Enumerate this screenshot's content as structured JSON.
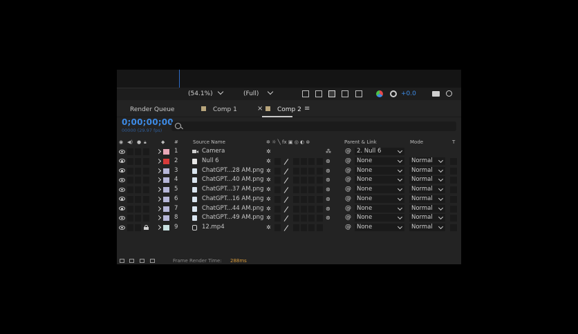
{
  "viewer": {
    "zoom": "(54.1%)",
    "resolution": "(Full)",
    "exposure": "+0.0"
  },
  "tabs": [
    {
      "label": "Render Queue",
      "active": false
    },
    {
      "label": "Comp 1",
      "active": false
    },
    {
      "label": "Comp 2",
      "active": true
    }
  ],
  "comp": {
    "timecode": "0;00;00;00",
    "frames": "00000 (29.97 fps)"
  },
  "columns": {
    "number": "#",
    "source_name": "Source Name",
    "parent_link": "Parent & Link",
    "mode": "Mode",
    "trkmat": "T"
  },
  "layers": [
    {
      "num": "1",
      "name": "Camera",
      "type": "camera",
      "label_color": "#e8a8b8",
      "parent": "2. Null 6",
      "mode": "",
      "locked": false
    },
    {
      "num": "2",
      "name": "Null 6",
      "type": "null",
      "label_color": "#d63a3a",
      "parent": "None",
      "mode": "Normal",
      "locked": false
    },
    {
      "num": "3",
      "name": "ChatGPT...28 AM.png",
      "type": "image",
      "label_color": "#b6b6d8",
      "parent": "None",
      "mode": "Normal",
      "locked": false
    },
    {
      "num": "4",
      "name": "ChatGPT...40 AM.png",
      "type": "image",
      "label_color": "#b6b6d8",
      "parent": "None",
      "mode": "Normal",
      "locked": false
    },
    {
      "num": "5",
      "name": "ChatGPT...37 AM.png",
      "type": "image",
      "label_color": "#b6b6d8",
      "parent": "None",
      "mode": "Normal",
      "locked": false
    },
    {
      "num": "6",
      "name": "ChatGPT...16 AM.png",
      "type": "image",
      "label_color": "#b6b6d8",
      "parent": "None",
      "mode": "Normal",
      "locked": false
    },
    {
      "num": "7",
      "name": "ChatGPT...44 AM.png",
      "type": "image",
      "label_color": "#b6b6d8",
      "parent": "None",
      "mode": "Normal",
      "locked": false
    },
    {
      "num": "8",
      "name": "ChatGPT...49 AM.png",
      "type": "image",
      "label_color": "#b6b6d8",
      "parent": "None",
      "mode": "Normal",
      "locked": false
    },
    {
      "num": "9",
      "name": "12.mp4",
      "type": "video",
      "label_color": "#c8e0e0",
      "parent": "None",
      "mode": "Normal",
      "locked": true
    }
  ],
  "status": {
    "frame_render_label": "Frame Render Time:",
    "frame_render_value": "288ms"
  },
  "colors": {
    "accent_blue": "#3d8be6",
    "panel_bg": "#232323"
  }
}
